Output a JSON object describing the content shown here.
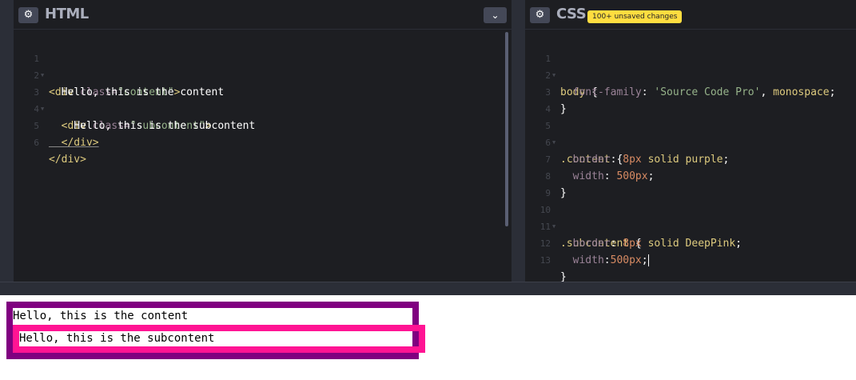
{
  "html_panel": {
    "title": "HTML",
    "settings_icon": "gear-icon",
    "collapse_icon": "chevron-down-icon"
  },
  "css_panel": {
    "title": "CSS",
    "badge": "100+ unsaved changes",
    "settings_icon": "gear-icon"
  },
  "html_lines": [
    {
      "n": "1",
      "t1": "<div ",
      "t2": "class=",
      "t3": "\"content\"",
      "t4": ">"
    },
    {
      "n": "2",
      "t1": "  Hello, this is the content"
    },
    {
      "n": "3",
      "t1": "  <div ",
      "t2": "class=",
      "t3": "\"subcontent\"",
      "t4": ">"
    },
    {
      "n": "4",
      "t1": "    Hello, this is the subcontent"
    },
    {
      "n": "5",
      "t1": "  </div>"
    },
    {
      "n": "6",
      "t1": "</div>"
    }
  ],
  "css_lines": [
    {
      "n": "1",
      "a": "body",
      "b": " {"
    },
    {
      "n": "2",
      "a": "  font-family",
      "b": ": ",
      "c": "'Source Code Pro'",
      "d": ", ",
      "e": "monospace",
      "f": ";"
    },
    {
      "n": "3",
      "a": "}"
    },
    {
      "n": "4"
    },
    {
      "n": "5",
      "a": ".content",
      "b": " {"
    },
    {
      "n": "6",
      "a": "  border",
      "b": ": ",
      "c": "8px",
      "d": " ",
      "e": "solid purple",
      "f": ";"
    },
    {
      "n": "7",
      "a": "  width",
      "b": ": ",
      "c": "500px",
      "f": ";"
    },
    {
      "n": "8",
      "a": "}"
    },
    {
      "n": "9"
    },
    {
      "n": "10",
      "a": ".subcontent",
      "b": " {"
    },
    {
      "n": "11",
      "a": "  border",
      "b": ": ",
      "c": "8px",
      "d": " ",
      "e": "solid DeepPink",
      "f": ";"
    },
    {
      "n": "12",
      "a": "  width",
      "b": ":",
      "c": "500px",
      "f": ";"
    },
    {
      "n": "13",
      "a": "}"
    }
  ],
  "preview": {
    "content_text": "Hello, this is the content",
    "subcontent_text": "Hello, this is the subcontent"
  },
  "colors": {
    "editor_bg": "#1d1e22",
    "chrome_bg": "#2b2e37",
    "badge_bg": "#ffdd40",
    "content_border": "purple",
    "subcontent_border": "deeppink"
  }
}
